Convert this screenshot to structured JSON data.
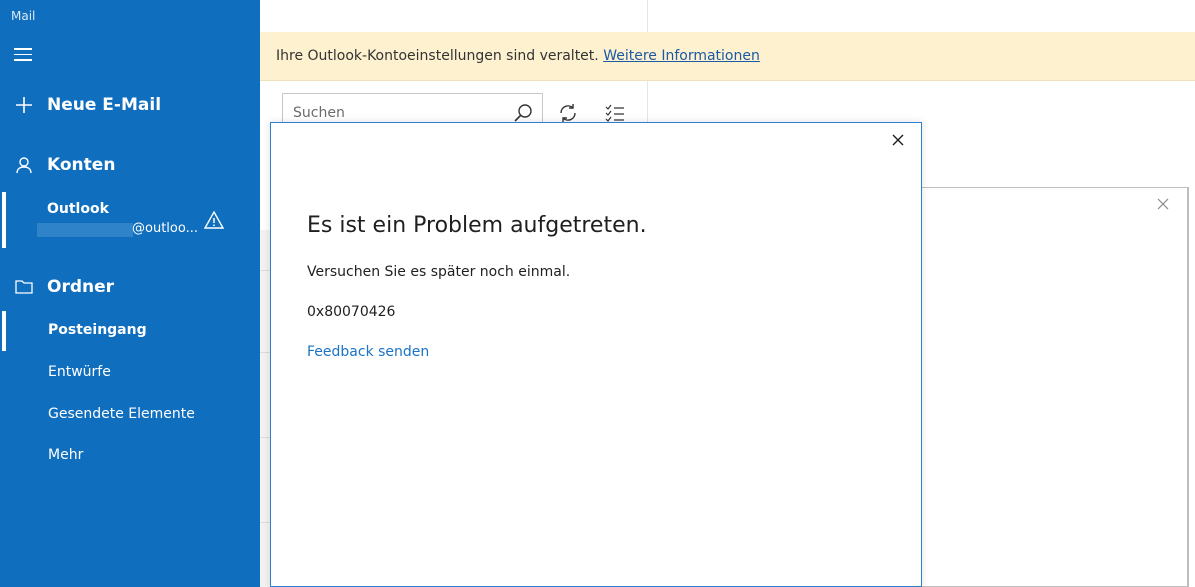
{
  "app": {
    "title": "Mail"
  },
  "sidebar": {
    "new_mail_label": "Neue E-Mail",
    "accounts_label": "Konten",
    "account": {
      "name": "Outlook",
      "email_suffix": "@outloo..."
    },
    "folders_label": "Ordner",
    "folders": [
      {
        "label": "Posteingang",
        "selected": true
      },
      {
        "label": "Entwürfe"
      },
      {
        "label": "Gesendete Elemente"
      },
      {
        "label": "Mehr"
      }
    ]
  },
  "banner": {
    "text": "Ihre Outlook-Kontoeinstellungen sind veraltet.",
    "link": "Weitere Informationen"
  },
  "search": {
    "placeholder": "Suchen"
  },
  "dialog": {
    "title": "Es ist ein Problem aufgetreten.",
    "message": "Versuchen Sie es später noch einmal.",
    "code": "0x80070426",
    "feedback_link": "Feedback senden"
  },
  "colors": {
    "sidebar": "#106ebe",
    "banner": "#fdf1cf",
    "link": "#1a73c7",
    "dialog_border": "#2f7fd0"
  }
}
